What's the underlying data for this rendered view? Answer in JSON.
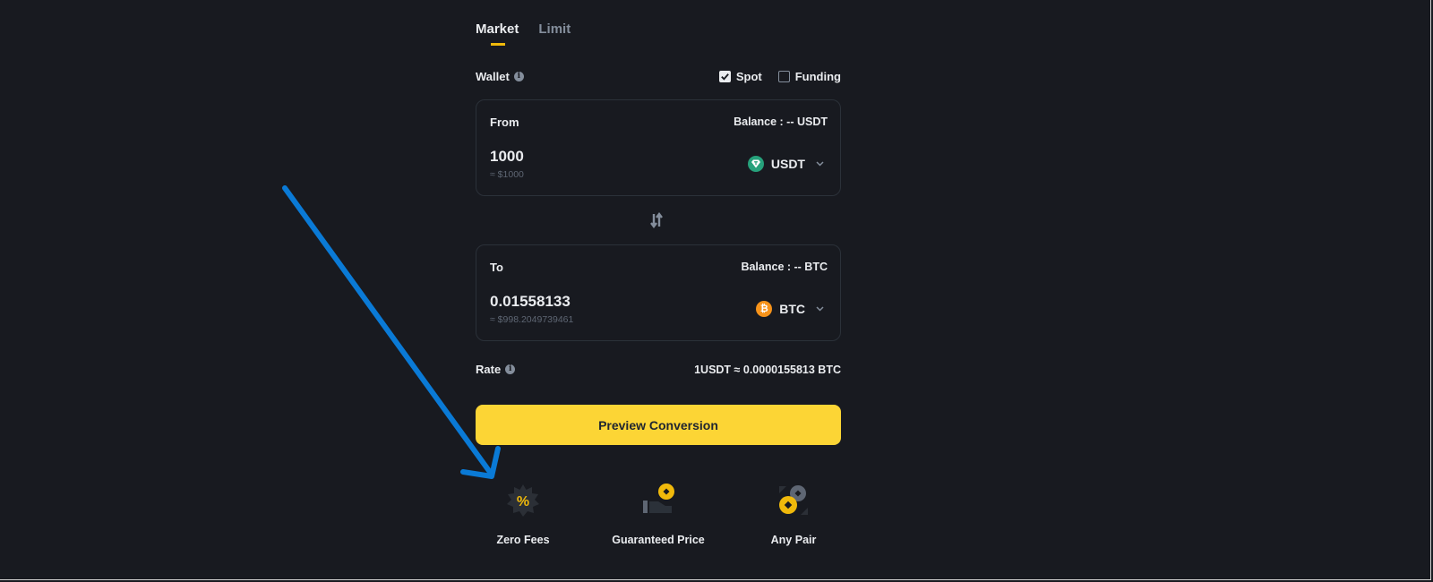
{
  "tabs": [
    {
      "label": "Market",
      "active": true
    },
    {
      "label": "Limit",
      "active": false
    }
  ],
  "wallet": {
    "label": "Wallet",
    "options": [
      {
        "label": "Spot",
        "checked": true
      },
      {
        "label": "Funding",
        "checked": false
      }
    ]
  },
  "from": {
    "label": "From",
    "balance": "Balance : -- USDT",
    "amount": "1000",
    "fiat": "≈ $1000",
    "coin": {
      "symbol": "USDT",
      "icon": "tether-icon",
      "color": "#26a17b"
    }
  },
  "to": {
    "label": "To",
    "balance": "Balance : -- BTC",
    "amount": "0.01558133",
    "fiat": "≈ $998.2049739461",
    "coin": {
      "symbol": "BTC",
      "icon": "bitcoin-icon",
      "glyph": "₿",
      "color": "#f7931a"
    }
  },
  "rate": {
    "label": "Rate",
    "value": "1USDT ≈ 0.0000155813 BTC"
  },
  "preview_button": "Preview Conversion",
  "features": [
    {
      "label": "Zero Fees",
      "icon": "percent-badge-icon"
    },
    {
      "label": "Guaranteed Price",
      "icon": "hand-coin-icon"
    },
    {
      "label": "Any Pair",
      "icon": "coin-pair-icon"
    }
  ],
  "annotation": {
    "type": "arrow",
    "color": "#0a7ad6",
    "points_to": "Zero Fees"
  },
  "colors": {
    "background": "#181a20",
    "accent": "#fcd535",
    "text": "#eaecef",
    "muted": "#848e9c"
  }
}
